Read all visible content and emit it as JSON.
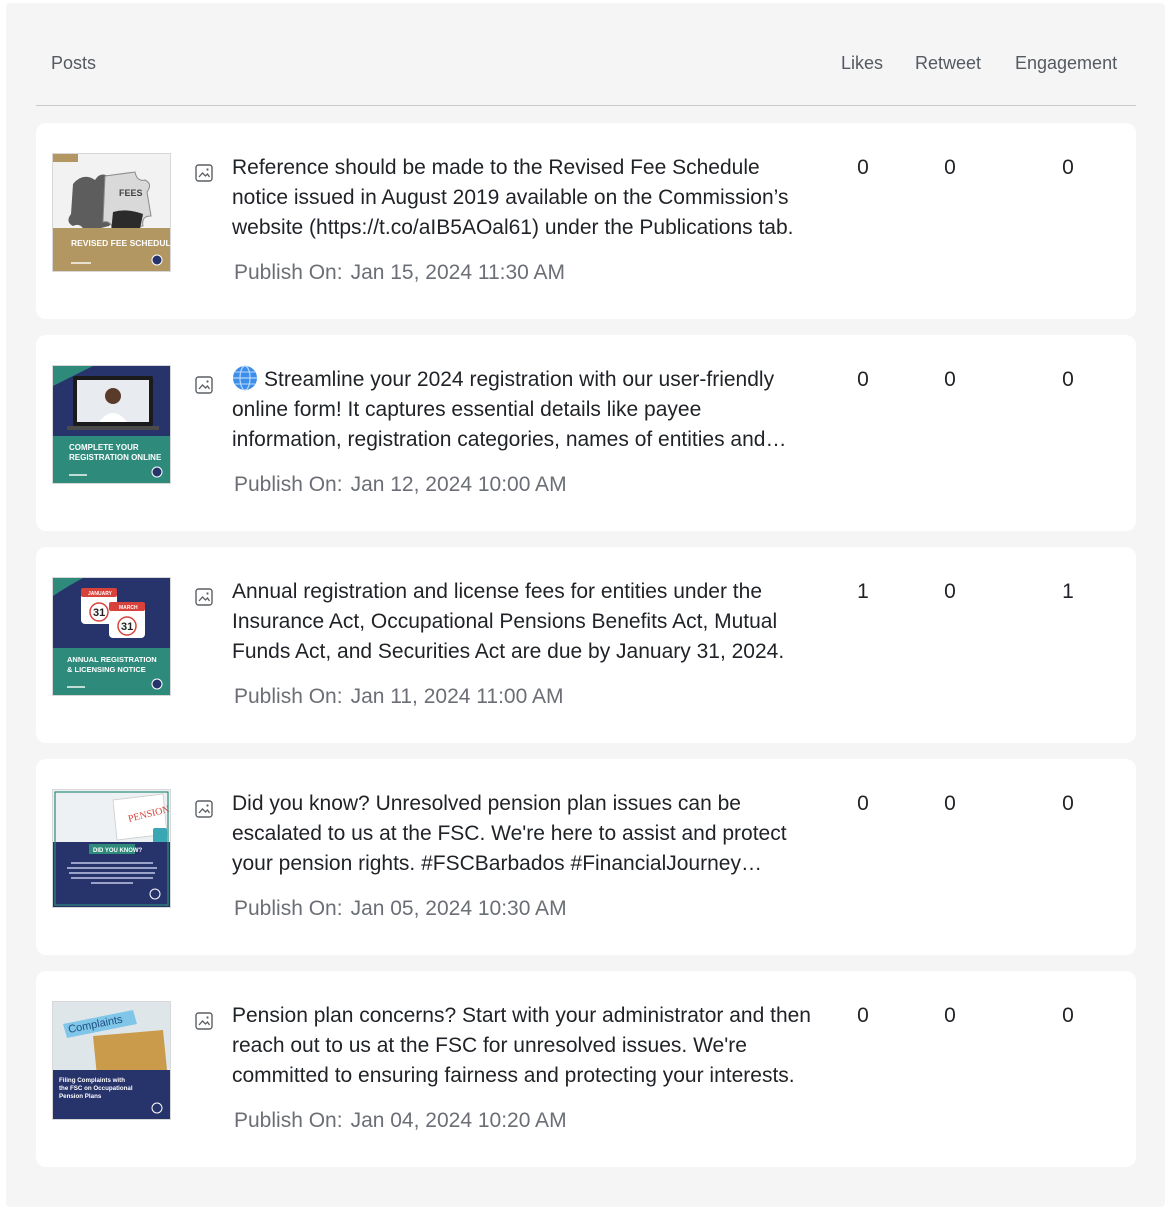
{
  "table": {
    "columns": {
      "posts": "Posts",
      "likes": "Likes",
      "retweet": "Retweet",
      "engagement": "Engagement"
    },
    "publish_label": "Publish On:",
    "rows": [
      {
        "thumbnail_caption": "REVISED FEE SCHEDULE",
        "thumbnail_sub": "FEES",
        "has_globe": false,
        "text": "Reference should be made to the Revised Fee Schedule notice issued in August 2019 available on the Commission’s website (https://t.co/aIB5AOal61) under the Publications tab.",
        "published": "Jan 15, 2024 11:30 AM",
        "likes": "0",
        "retweet": "0",
        "engagement": "0"
      },
      {
        "thumbnail_caption": "COMPLETE YOUR REGISTRATION ONLINE",
        "has_globe": true,
        "text": "Streamline your 2024 registration with our user-friendly online form! It captures essential details like payee information, registration categories, names of entities and more.",
        "published": "Jan 12, 2024 10:00 AM",
        "likes": "0",
        "retweet": "0",
        "engagement": "0"
      },
      {
        "thumbnail_caption": "ANNUAL REGISTRATION & LICENSING NOTICE",
        "thumbnail_cal1": "JANUARY",
        "thumbnail_cal2": "MARCH",
        "thumbnail_day": "31",
        "has_globe": false,
        "text": "Annual registration and license fees for entities under the Insurance Act, Occupational Pensions Benefits Act, Mutual Funds Act, and Securities Act are due by January 31, 2024.",
        "published": "Jan 11, 2024 11:00 AM",
        "likes": "1",
        "retweet": "0",
        "engagement": "1"
      },
      {
        "thumbnail_caption": "DID YOU KNOW?",
        "thumbnail_sub": "PENSION",
        "has_globe": false,
        "text": "Did you know? Unresolved pension plan issues can be escalated to us at the FSC. We're here to assist and protect your pension rights. #FSCBarbados #FinancialJourney #Pensions",
        "published": "Jan 05, 2024 10:30 AM",
        "likes": "0",
        "retweet": "0",
        "engagement": "0"
      },
      {
        "thumbnail_caption": "Filing Complaints with the FSC on Occupational Pension Plans",
        "thumbnail_sub": "Complaints",
        "has_globe": false,
        "text": "Pension plan concerns? Start with your administrator and then reach out to us at the FSC for unresolved issues. We're committed to ensuring fairness and protecting your interests.",
        "published": "Jan 04, 2024 10:20 AM",
        "likes": "0",
        "retweet": "0",
        "engagement": "0"
      }
    ]
  },
  "colors": {
    "navy": "#27336b",
    "teal": "#2e8a7a",
    "gold": "#b39763",
    "page_bg": "#f5f5f6"
  }
}
